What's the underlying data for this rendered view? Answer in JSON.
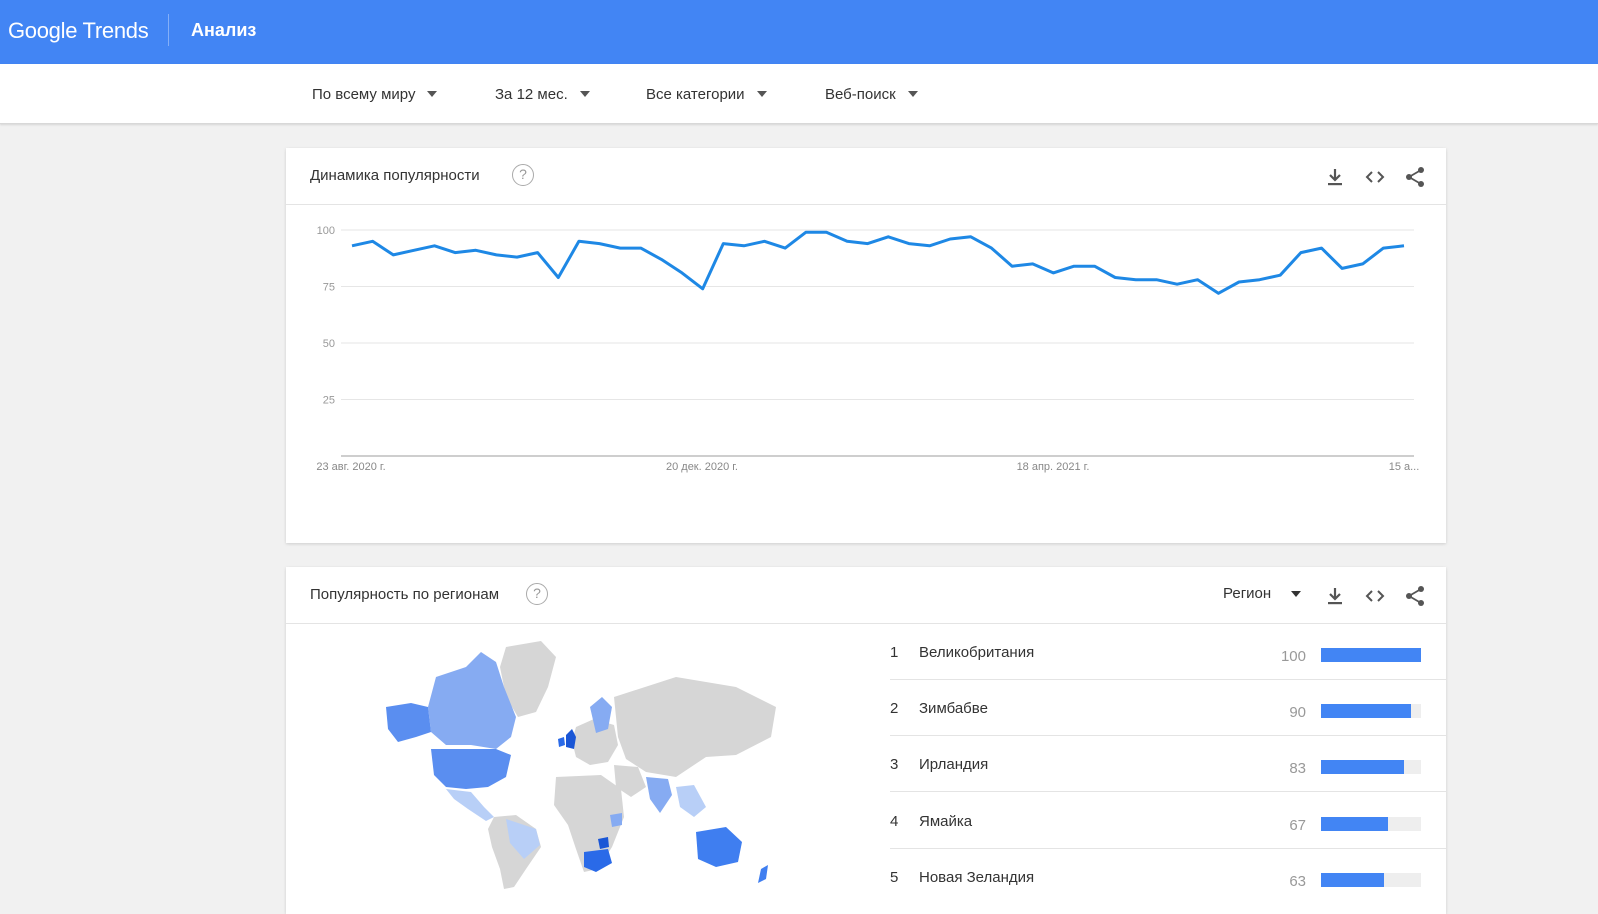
{
  "header": {
    "logo": "Google Trends",
    "title": "Анализ"
  },
  "filters": [
    {
      "label": "По всему миру"
    },
    {
      "label": "За 12 мес."
    },
    {
      "label": "Все категории"
    },
    {
      "label": "Веб-поиск"
    }
  ],
  "interest_over_time": {
    "title": "Динамика популярности",
    "help": "?"
  },
  "chart_data": {
    "type": "line",
    "title": "",
    "xlabel": "",
    "ylabel": "",
    "ylim": [
      0,
      100
    ],
    "yticks": [
      25,
      50,
      75,
      100
    ],
    "x_tick_labels": [
      "23 авг. 2020 г.",
      "20 дек. 2020 г.",
      "18 апр. 2021 г.",
      "15 а..."
    ],
    "grid": true,
    "series": [
      {
        "values": [
          93,
          95,
          89,
          91,
          93,
          90,
          91,
          89,
          88,
          90,
          79,
          95,
          94,
          92,
          92,
          87,
          81,
          74,
          94,
          93,
          95,
          92,
          99,
          99,
          95,
          94,
          97,
          94,
          93,
          96,
          97,
          92,
          84,
          85,
          81,
          84,
          84,
          79,
          78,
          78,
          76,
          78,
          72,
          77,
          78,
          80,
          90,
          92,
          83,
          85,
          92,
          93
        ]
      }
    ],
    "colors": {
      "line": "#1e88e5"
    }
  },
  "interest_by_region": {
    "title": "Популярность по регионам",
    "help": "?",
    "resolution_label": "Регион",
    "rows": [
      {
        "rank": "1",
        "name": "Великобритания",
        "value": 100
      },
      {
        "rank": "2",
        "name": "Зимбабве",
        "value": 90
      },
      {
        "rank": "3",
        "name": "Ирландия",
        "value": 83
      },
      {
        "rank": "4",
        "name": "Ямайка",
        "value": 67
      },
      {
        "rank": "5",
        "name": "Новая Зеландия",
        "value": 63
      }
    ]
  },
  "colors": {
    "brand": "#4285f4",
    "bar": "#4285f4",
    "bar_bg": "#eeeeee"
  },
  "icons": [
    "download-icon",
    "embed-code-icon",
    "share-icon",
    "help-icon",
    "dropdown-caret-icon"
  ]
}
